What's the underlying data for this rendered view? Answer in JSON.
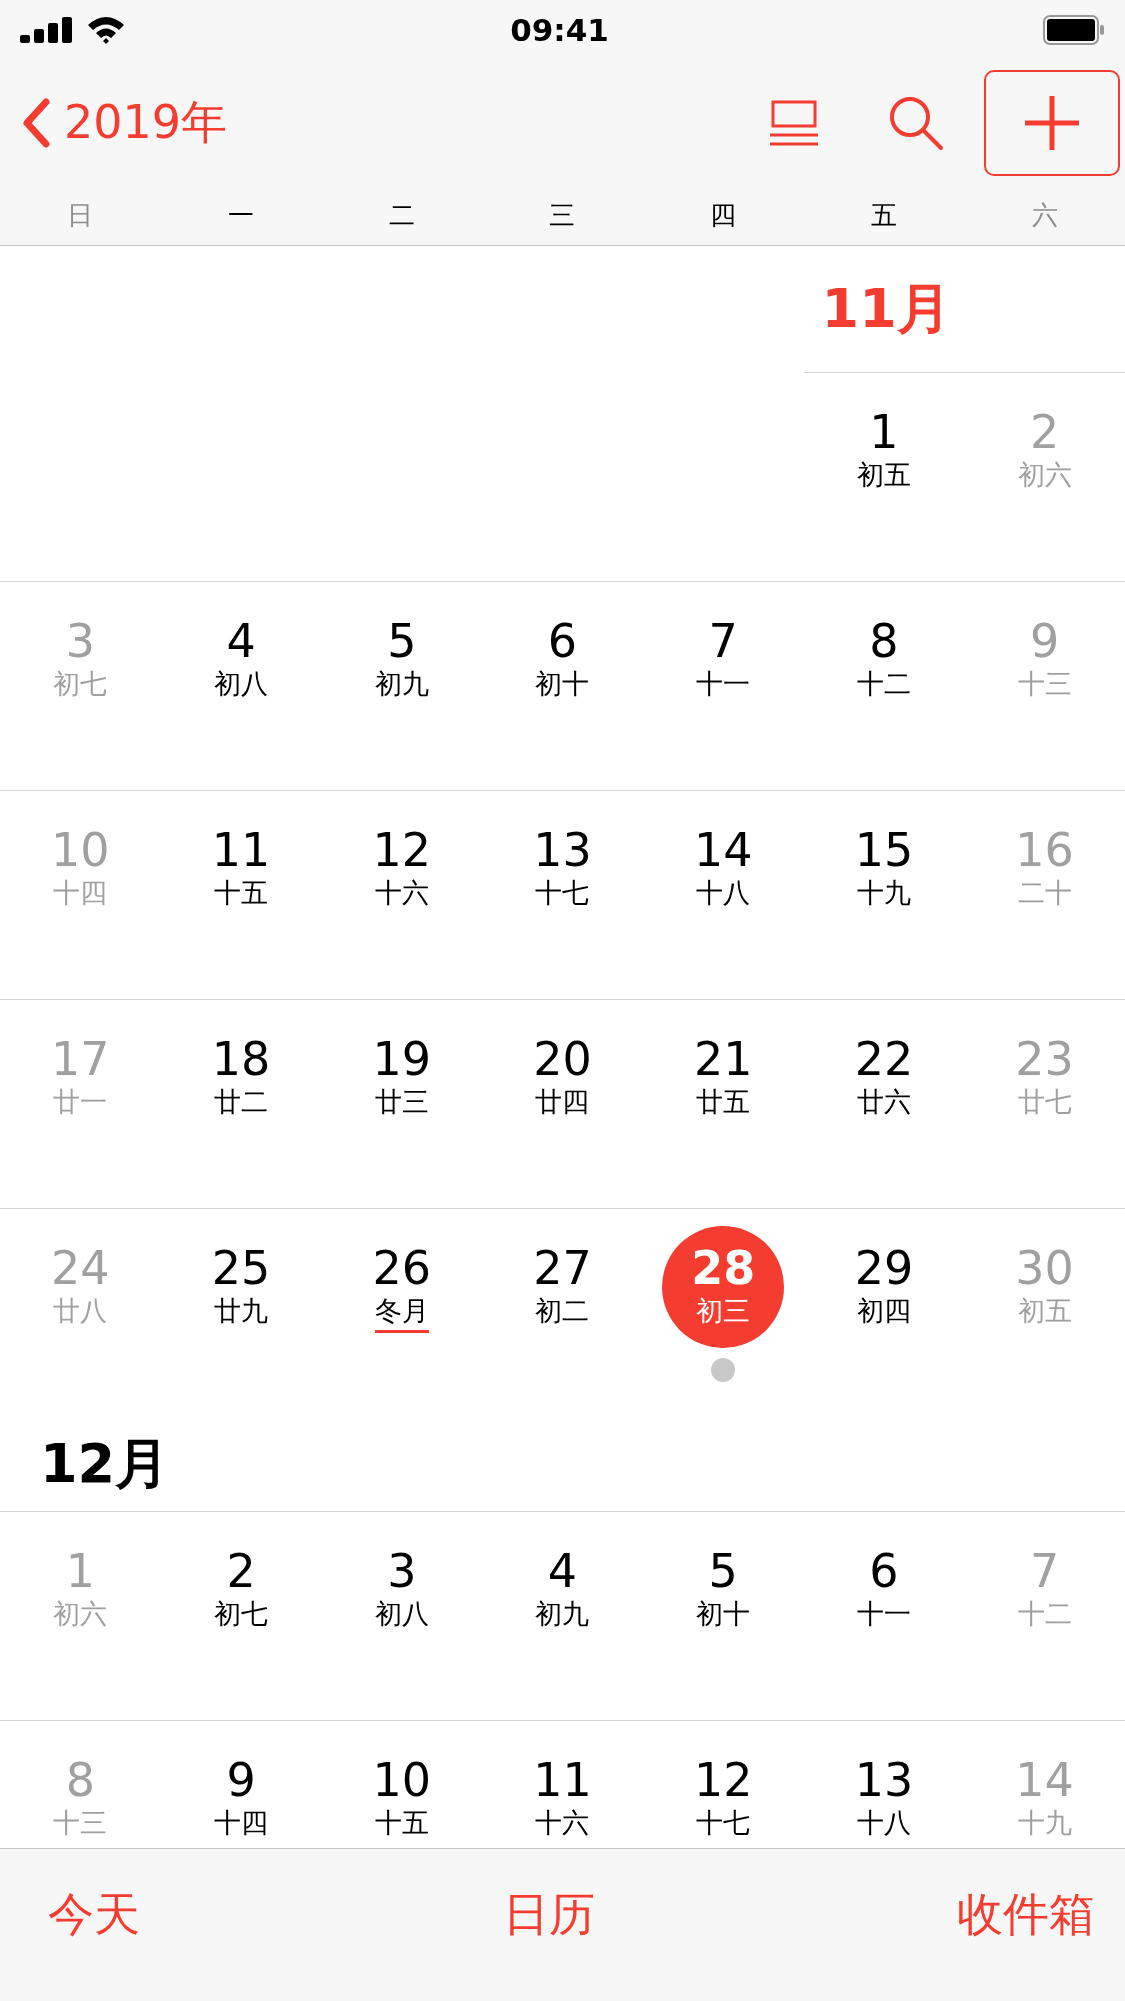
{
  "status_bar": {
    "time": "09:41"
  },
  "nav": {
    "back_label": "2019年",
    "add_focused": true
  },
  "weekdays": [
    {
      "label": "日",
      "dimmed": true
    },
    {
      "label": "一",
      "dimmed": false
    },
    {
      "label": "二",
      "dimmed": false
    },
    {
      "label": "三",
      "dimmed": false
    },
    {
      "label": "四",
      "dimmed": false
    },
    {
      "label": "五",
      "dimmed": false
    },
    {
      "label": "六",
      "dimmed": true
    }
  ],
  "months": [
    {
      "label": "11月",
      "current": true,
      "weeks": [
        {
          "days": [
            {
              "kind": "blank"
            },
            {
              "kind": "blank"
            },
            {
              "kind": "blank"
            },
            {
              "kind": "blank"
            },
            {
              "kind": "blank"
            },
            {
              "kind": "day",
              "d": "1",
              "lunar": "初五",
              "dimmed": false,
              "selected": false,
              "event": false,
              "underline": false
            },
            {
              "kind": "day",
              "d": "2",
              "lunar": "初六",
              "dimmed": true,
              "selected": false,
              "event": false,
              "underline": false
            }
          ]
        },
        {
          "days": [
            {
              "kind": "day",
              "d": "3",
              "lunar": "初七",
              "dimmed": true,
              "selected": false,
              "event": false,
              "underline": false
            },
            {
              "kind": "day",
              "d": "4",
              "lunar": "初八",
              "dimmed": false,
              "selected": false,
              "event": false,
              "underline": false
            },
            {
              "kind": "day",
              "d": "5",
              "lunar": "初九",
              "dimmed": false,
              "selected": false,
              "event": false,
              "underline": false
            },
            {
              "kind": "day",
              "d": "6",
              "lunar": "初十",
              "dimmed": false,
              "selected": false,
              "event": false,
              "underline": false
            },
            {
              "kind": "day",
              "d": "7",
              "lunar": "十一",
              "dimmed": false,
              "selected": false,
              "event": false,
              "underline": false
            },
            {
              "kind": "day",
              "d": "8",
              "lunar": "十二",
              "dimmed": false,
              "selected": false,
              "event": false,
              "underline": false
            },
            {
              "kind": "day",
              "d": "9",
              "lunar": "十三",
              "dimmed": true,
              "selected": false,
              "event": false,
              "underline": false
            }
          ]
        },
        {
          "days": [
            {
              "kind": "day",
              "d": "10",
              "lunar": "十四",
              "dimmed": true,
              "selected": false,
              "event": false,
              "underline": false
            },
            {
              "kind": "day",
              "d": "11",
              "lunar": "十五",
              "dimmed": false,
              "selected": false,
              "event": false,
              "underline": false
            },
            {
              "kind": "day",
              "d": "12",
              "lunar": "十六",
              "dimmed": false,
              "selected": false,
              "event": false,
              "underline": false
            },
            {
              "kind": "day",
              "d": "13",
              "lunar": "十七",
              "dimmed": false,
              "selected": false,
              "event": false,
              "underline": false
            },
            {
              "kind": "day",
              "d": "14",
              "lunar": "十八",
              "dimmed": false,
              "selected": false,
              "event": false,
              "underline": false
            },
            {
              "kind": "day",
              "d": "15",
              "lunar": "十九",
              "dimmed": false,
              "selected": false,
              "event": false,
              "underline": false
            },
            {
              "kind": "day",
              "d": "16",
              "lunar": "二十",
              "dimmed": true,
              "selected": false,
              "event": false,
              "underline": false
            }
          ]
        },
        {
          "days": [
            {
              "kind": "day",
              "d": "17",
              "lunar": "廿一",
              "dimmed": true,
              "selected": false,
              "event": false,
              "underline": false
            },
            {
              "kind": "day",
              "d": "18",
              "lunar": "廿二",
              "dimmed": false,
              "selected": false,
              "event": false,
              "underline": false
            },
            {
              "kind": "day",
              "d": "19",
              "lunar": "廿三",
              "dimmed": false,
              "selected": false,
              "event": false,
              "underline": false
            },
            {
              "kind": "day",
              "d": "20",
              "lunar": "廿四",
              "dimmed": false,
              "selected": false,
              "event": false,
              "underline": false
            },
            {
              "kind": "day",
              "d": "21",
              "lunar": "廿五",
              "dimmed": false,
              "selected": false,
              "event": false,
              "underline": false
            },
            {
              "kind": "day",
              "d": "22",
              "lunar": "廿六",
              "dimmed": false,
              "selected": false,
              "event": false,
              "underline": false
            },
            {
              "kind": "day",
              "d": "23",
              "lunar": "廿七",
              "dimmed": true,
              "selected": false,
              "event": false,
              "underline": false
            }
          ]
        },
        {
          "days": [
            {
              "kind": "day",
              "d": "24",
              "lunar": "廿八",
              "dimmed": true,
              "selected": false,
              "event": false,
              "underline": false
            },
            {
              "kind": "day",
              "d": "25",
              "lunar": "廿九",
              "dimmed": false,
              "selected": false,
              "event": false,
              "underline": false
            },
            {
              "kind": "day",
              "d": "26",
              "lunar": "冬月",
              "dimmed": false,
              "selected": false,
              "event": false,
              "underline": true
            },
            {
              "kind": "day",
              "d": "27",
              "lunar": "初二",
              "dimmed": false,
              "selected": false,
              "event": false,
              "underline": false
            },
            {
              "kind": "day",
              "d": "28",
              "lunar": "初三",
              "dimmed": false,
              "selected": true,
              "event": true,
              "underline": false
            },
            {
              "kind": "day",
              "d": "29",
              "lunar": "初四",
              "dimmed": false,
              "selected": false,
              "event": false,
              "underline": false
            },
            {
              "kind": "day",
              "d": "30",
              "lunar": "初五",
              "dimmed": true,
              "selected": false,
              "event": false,
              "underline": false
            }
          ]
        }
      ]
    },
    {
      "label": "12月",
      "current": false,
      "weeks": [
        {
          "days": [
            {
              "kind": "day",
              "d": "1",
              "lunar": "初六",
              "dimmed": true,
              "selected": false,
              "event": false,
              "underline": false
            },
            {
              "kind": "day",
              "d": "2",
              "lunar": "初七",
              "dimmed": false,
              "selected": false,
              "event": false,
              "underline": false
            },
            {
              "kind": "day",
              "d": "3",
              "lunar": "初八",
              "dimmed": false,
              "selected": false,
              "event": false,
              "underline": false
            },
            {
              "kind": "day",
              "d": "4",
              "lunar": "初九",
              "dimmed": false,
              "selected": false,
              "event": false,
              "underline": false
            },
            {
              "kind": "day",
              "d": "5",
              "lunar": "初十",
              "dimmed": false,
              "selected": false,
              "event": false,
              "underline": false
            },
            {
              "kind": "day",
              "d": "6",
              "lunar": "十一",
              "dimmed": false,
              "selected": false,
              "event": false,
              "underline": false
            },
            {
              "kind": "day",
              "d": "7",
              "lunar": "十二",
              "dimmed": true,
              "selected": false,
              "event": false,
              "underline": false
            }
          ]
        },
        {
          "days": [
            {
              "kind": "day",
              "d": "8",
              "lunar": "十三",
              "dimmed": true,
              "selected": false,
              "event": false,
              "underline": false
            },
            {
              "kind": "day",
              "d": "9",
              "lunar": "十四",
              "dimmed": false,
              "selected": false,
              "event": false,
              "underline": false
            },
            {
              "kind": "day",
              "d": "10",
              "lunar": "十五",
              "dimmed": false,
              "selected": false,
              "event": false,
              "underline": false
            },
            {
              "kind": "day",
              "d": "11",
              "lunar": "十六",
              "dimmed": false,
              "selected": false,
              "event": false,
              "underline": false
            },
            {
              "kind": "day",
              "d": "12",
              "lunar": "十七",
              "dimmed": false,
              "selected": false,
              "event": false,
              "underline": false
            },
            {
              "kind": "day",
              "d": "13",
              "lunar": "十八",
              "dimmed": false,
              "selected": false,
              "event": false,
              "underline": false
            },
            {
              "kind": "day",
              "d": "14",
              "lunar": "十九",
              "dimmed": true,
              "selected": false,
              "event": false,
              "underline": false
            }
          ]
        }
      ]
    }
  ],
  "tab_bar": [
    {
      "label": "今天"
    },
    {
      "label": "日历"
    },
    {
      "label": "收件箱"
    }
  ]
}
